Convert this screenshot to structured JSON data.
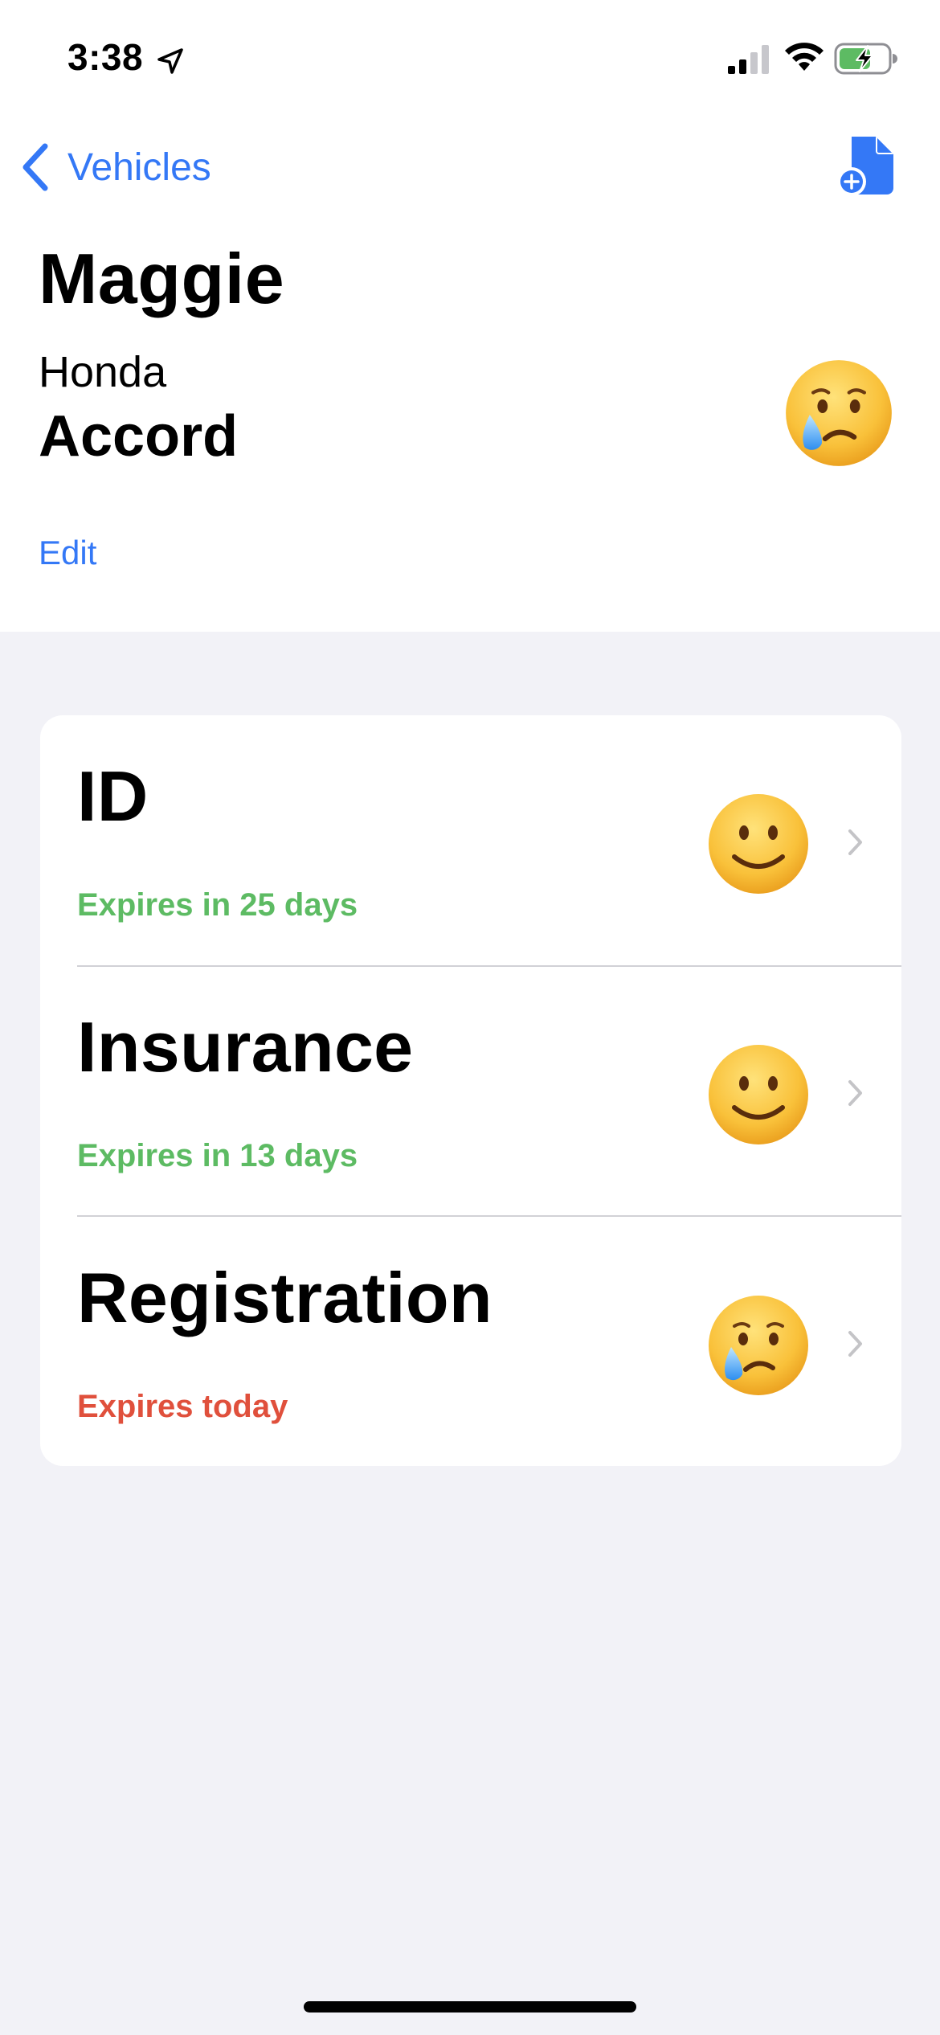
{
  "status_bar": {
    "time": "3:38"
  },
  "nav": {
    "back_label": "Vehicles"
  },
  "vehicle": {
    "name": "Maggie",
    "make": "Honda",
    "model": "Accord",
    "mood_icon": "crying-face-icon",
    "edit_label": "Edit"
  },
  "documents": [
    {
      "title": "ID",
      "status": "Expires in 25 days",
      "status_color": "#5dbb63",
      "mood_icon": "smiling-face-icon"
    },
    {
      "title": "Insurance",
      "status": "Expires in 13 days",
      "status_color": "#5dbb63",
      "mood_icon": "smiling-face-icon"
    },
    {
      "title": "Registration",
      "status": "Expires today",
      "status_color": "#e0503c",
      "mood_icon": "crying-face-icon"
    }
  ],
  "colors": {
    "accent": "#3478f6",
    "background": "#f2f2f7",
    "ok": "#5dbb63",
    "expired": "#e0503c"
  }
}
